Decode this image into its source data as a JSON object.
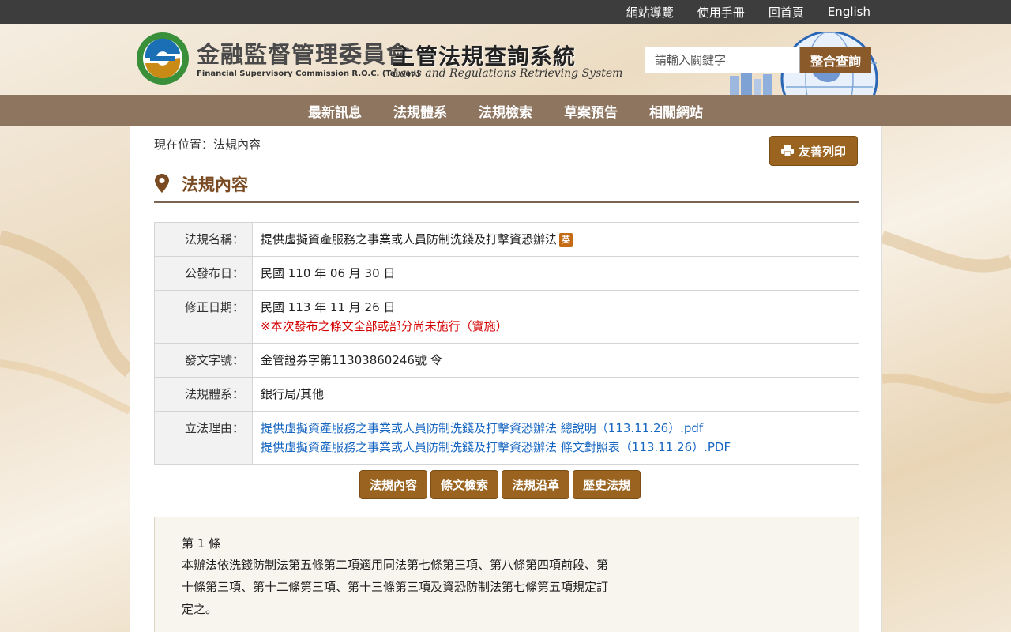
{
  "topbar": {
    "links": [
      "網站導覽",
      "使用手冊",
      "回首頁",
      "English"
    ]
  },
  "header": {
    "fsc_name": "金融監督管理委員會",
    "fsc_en": "Financial Supervisory Commission R.O.C. (Taiwan)",
    "system_name": "主管法規查詢系統",
    "system_en": "Laws and Regulations Retrieving System",
    "search_placeholder": "請輸入關鍵字",
    "search_button": "整合查詢"
  },
  "nav": {
    "items": [
      "最新訊息",
      "法規體系",
      "法規檢索",
      "草案預告",
      "相關網站"
    ]
  },
  "breadcrumb": "現在位置：法規內容",
  "print_button": "友善列印",
  "page_title": "法規內容",
  "info": {
    "name_label": "法規名稱：",
    "name_value": "提供虛擬資產服務之事業或人員防制洗錢及打擊資恐辦法",
    "name_badge": "英",
    "publish_label": "公發布日：",
    "publish_value": "民國 110 年 06 月 30 日",
    "amend_label": "修正日期：",
    "amend_value": "民國 113 年 11 月 26 日",
    "amend_note": "※本次發布之條文全部或部分尚未施行（實施）",
    "doc_label": "發文字號：",
    "doc_value": "金管證券字第11303860246號 令",
    "system_label": "法規體系：",
    "system_value": "銀行局/其他",
    "reason_label": "立法理由：",
    "reason_links": [
      "提供虛擬資產服務之事業或人員防制洗錢及打擊資恐辦法 總說明（113.11.26）.pdf",
      "提供虛擬資產服務之事業或人員防制洗錢及打擊資恐辦法 條文對照表（113.11.26）.PDF"
    ]
  },
  "tabs": [
    "法規內容",
    "條文檢索",
    "法規沿革",
    "歷史法規"
  ],
  "article": {
    "number": "第 1 條",
    "text": "本辦法依洗錢防制法第五條第二項適用同法第七條第三項、第八條第四項前段、第十條第三項、第十二條第三項、第十三條第三項及資恐防制法第七條第五項規定訂定之。"
  },
  "colors": {
    "brown_button": "#9a6420",
    "nav_bar": "#8e7560",
    "topbar": "#3d3d3d",
    "link": "#1565c0",
    "warning": "#d40000"
  }
}
